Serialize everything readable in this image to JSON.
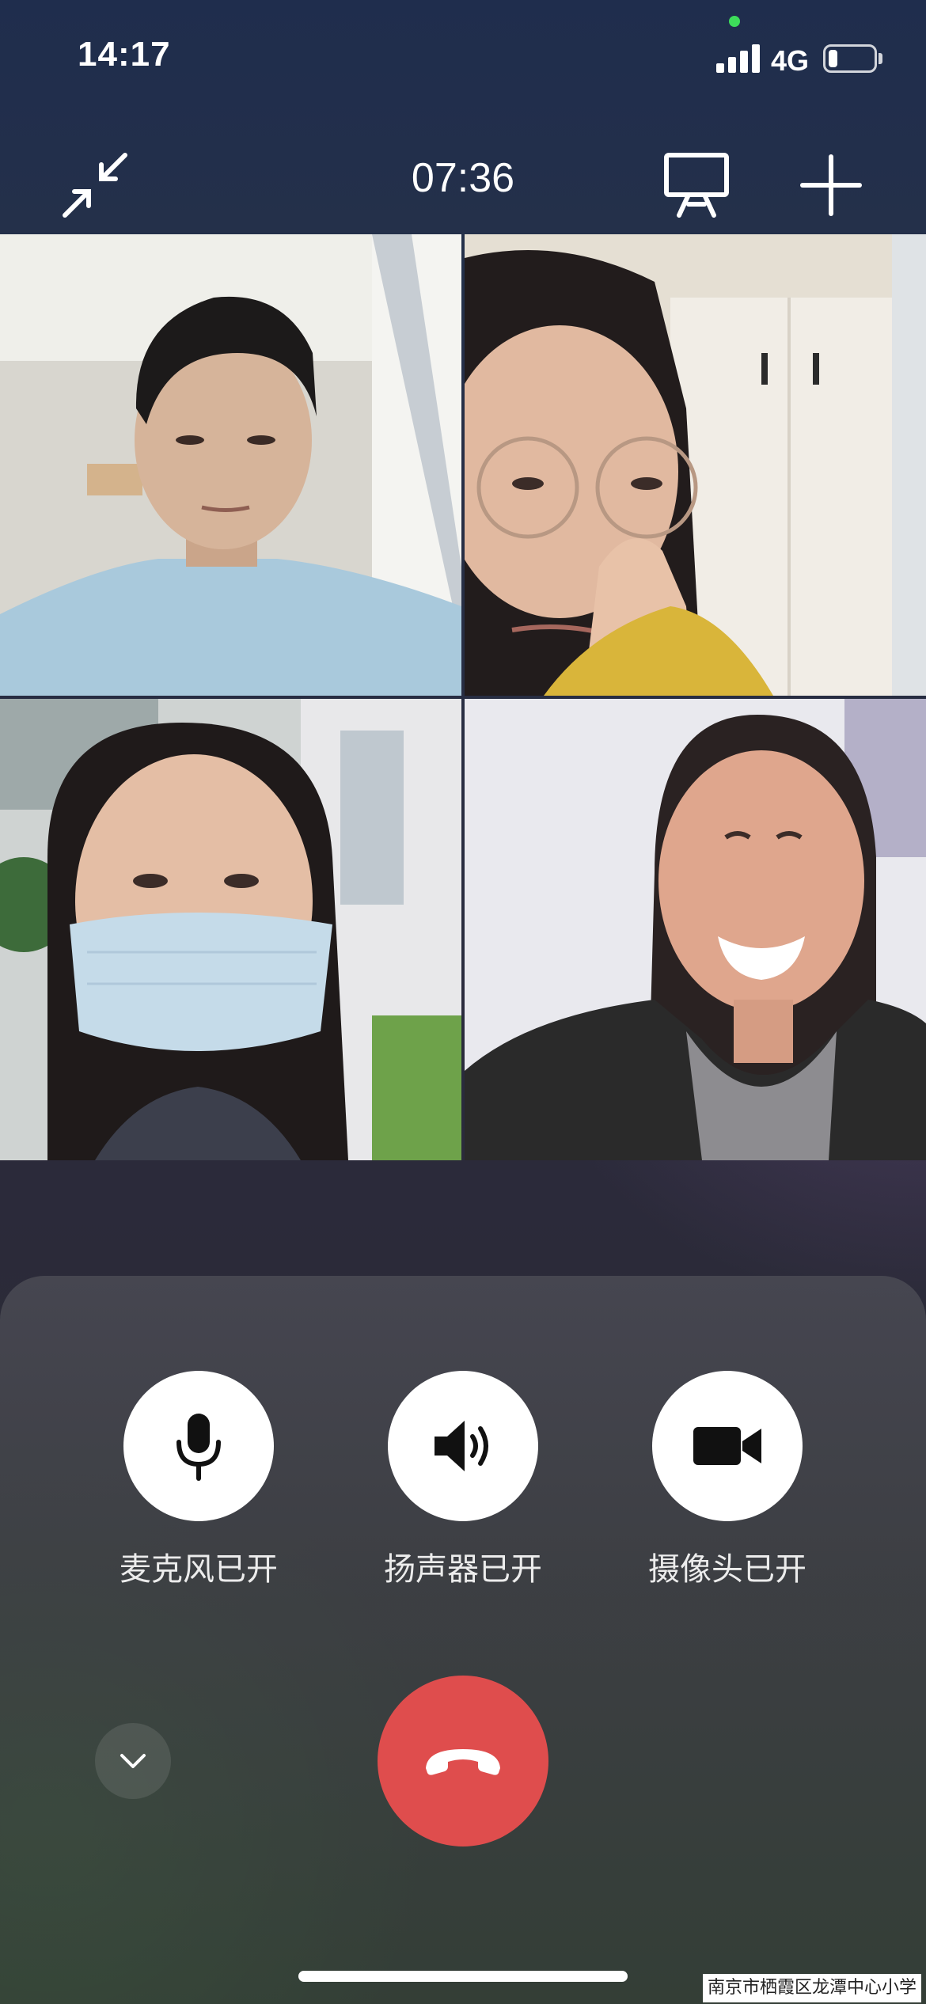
{
  "status_bar": {
    "time": "14:17",
    "network": "4G",
    "battery_level": 0.2,
    "signal_bars": 4
  },
  "call_bar": {
    "duration": "07:36",
    "icons": {
      "minimize": "minimize-arrows-icon",
      "present": "screen-share-icon",
      "add": "plus-icon"
    }
  },
  "participants": [
    {
      "position": "top-left",
      "shirt_color": "#a9c9dc",
      "background_color": "#d8d6cf"
    },
    {
      "position": "top-right",
      "shirt_color": "#d9b53a",
      "background_color": "#e5dfd3"
    },
    {
      "position": "bottom-left",
      "shirt_color": "#3c3f4c",
      "background_color": "#cfd3d2",
      "mask_color": "#c5dbe9"
    },
    {
      "position": "bottom-right",
      "shirt_color": "#2a2a2a",
      "background_color": "#e9e9ee"
    }
  ],
  "controls": {
    "microphone": {
      "label": "麦克风已开",
      "icon": "microphone-icon"
    },
    "speaker": {
      "label": "扬声器已开",
      "icon": "speaker-icon"
    },
    "camera": {
      "label": "摄像头已开",
      "icon": "video-camera-icon"
    }
  },
  "actions": {
    "collapse_icon": "chevron-down-icon",
    "hangup_icon": "hang-up-phone-icon",
    "hangup_color": "#df4d4d"
  },
  "watermark": "南京市栖霞区龙潭中心小学"
}
